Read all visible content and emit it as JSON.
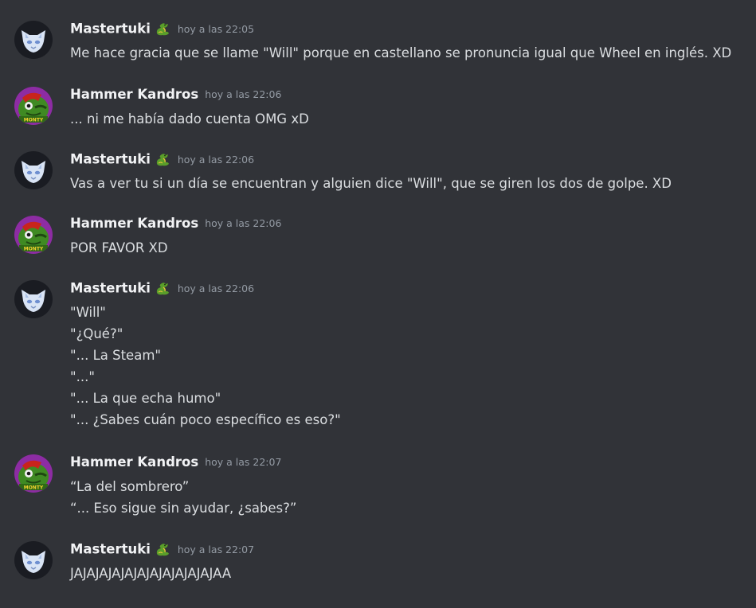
{
  "messages": [
    {
      "author": "Mastertuki",
      "kind": "tuki",
      "badge": "dragon-icon",
      "time": "hoy a las 22:05",
      "lines": [
        "Me hace gracia que se llame \"Will\" porque en castellano se pronuncia igual que Wheel en inglés. XD"
      ]
    },
    {
      "author": "Hammer Kandros",
      "kind": "hammer",
      "time": "hoy a las 22:06",
      "lines": [
        "... ni me había dado cuenta OMG xD"
      ]
    },
    {
      "author": "Mastertuki",
      "kind": "tuki",
      "badge": "dragon-icon",
      "time": "hoy a las 22:06",
      "lines": [
        "Vas a ver tu si un día se encuentran y alguien dice \"Will\", que se giren los dos de golpe. XD"
      ]
    },
    {
      "author": "Hammer Kandros",
      "kind": "hammer",
      "time": "hoy a las 22:06",
      "lines": [
        "POR FAVOR XD"
      ]
    },
    {
      "author": "Mastertuki",
      "kind": "tuki",
      "badge": "dragon-icon",
      "time": "hoy a las 22:06",
      "lines": [
        "\"Will\"",
        "\"¿Qué?\"",
        "\"... La Steam\"",
        "\"...\"",
        "\"... La que echa humo\"",
        "\"... ¿Sabes cuán poco específico es eso?\""
      ]
    },
    {
      "author": "Hammer Kandros",
      "kind": "hammer",
      "time": "hoy a las 22:07",
      "lines": [
        "“La del sombrero”",
        "“... Eso sigue sin ayudar, ¿sabes?”"
      ]
    },
    {
      "author": "Mastertuki",
      "kind": "tuki",
      "badge": "dragon-icon",
      "time": "hoy a las 22:07",
      "lines": [
        "JAJAJAJAJAJAJAJAJAJAJAJAA"
      ]
    }
  ],
  "avatar_labels": {
    "hammer": "MONTY"
  },
  "colors": {
    "background": "#313338",
    "author": "#f2f3f5",
    "text": "#dbdee1",
    "timestamp": "#949ba4"
  }
}
